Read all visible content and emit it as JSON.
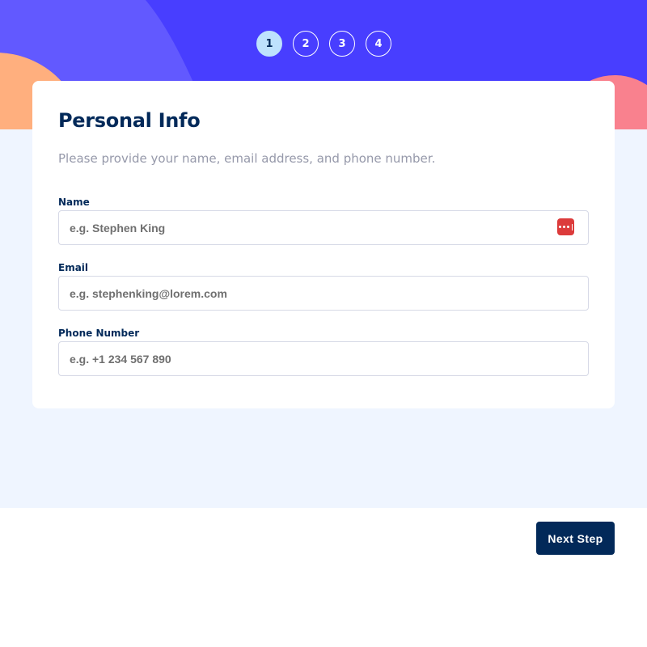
{
  "colors": {
    "hero": "#483eff",
    "accent_orange": "#ffaf7e",
    "accent_pink": "#f9818e",
    "page_bg": "#eff5ff",
    "marine_blue": "#022959",
    "active_step": "#bee2fd",
    "placeholder": "#6f6f6f",
    "subtitle": "#9699aa",
    "password_manager_icon": "#dc3b3b"
  },
  "steps": [
    {
      "label": "1",
      "active": true
    },
    {
      "label": "2",
      "active": false
    },
    {
      "label": "3",
      "active": false
    },
    {
      "label": "4",
      "active": false
    }
  ],
  "form": {
    "title": "Personal Info",
    "subtitle": "Please provide your name, email address, and phone number.",
    "fields": [
      {
        "label": "Name",
        "placeholder": "e.g. Stephen King",
        "value": ""
      },
      {
        "label": "Email",
        "placeholder": "e.g. stephenking@lorem.com",
        "value": ""
      },
      {
        "label": "Phone Number",
        "placeholder": "e.g. +1 234 567 890",
        "value": ""
      }
    ],
    "name_field_icon": "password-manager-icon"
  },
  "footer": {
    "next_label": "Next Step"
  }
}
